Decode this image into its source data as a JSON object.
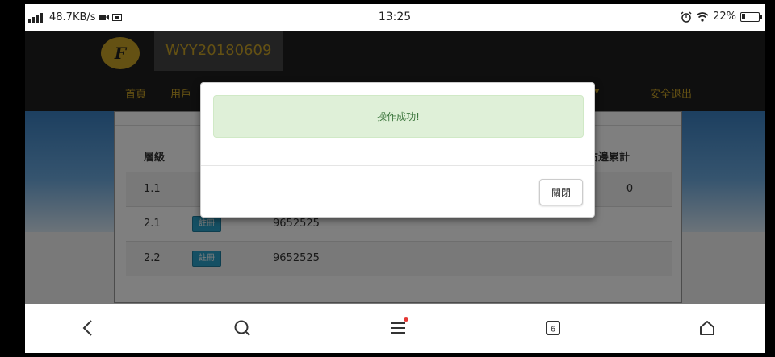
{
  "status_bar": {
    "network_speed": "48.7KB/s",
    "time": "13:25",
    "battery": "22%"
  },
  "site": {
    "logo_text": "F",
    "title": "WYY20180609",
    "nav": [
      "首頁",
      "用戶",
      "安全退出"
    ]
  },
  "table": {
    "headers": [
      "層級",
      "",
      "",
      "右邊累計"
    ],
    "rows": [
      {
        "level": "1.1",
        "button": "",
        "value": "",
        "right_total": "0"
      },
      {
        "level": "2.1",
        "button": "註冊",
        "value": "9652525",
        "right_total": ""
      },
      {
        "level": "2.2",
        "button": "註冊",
        "value": "9652525",
        "right_total": ""
      }
    ]
  },
  "modal": {
    "message": "操作成功!",
    "close_label": "關閉"
  },
  "bottom_bar": {
    "tab_count": "6",
    "icons": [
      "back-icon",
      "search-icon",
      "menu-icon",
      "tabs-icon",
      "home-icon"
    ]
  },
  "colors": {
    "nav_bg": "#1e1e1e",
    "gold": "#c9a227",
    "success_bg": "#dff0d8",
    "success_text": "#3c763d",
    "button_blue": "#2aa1c8"
  }
}
